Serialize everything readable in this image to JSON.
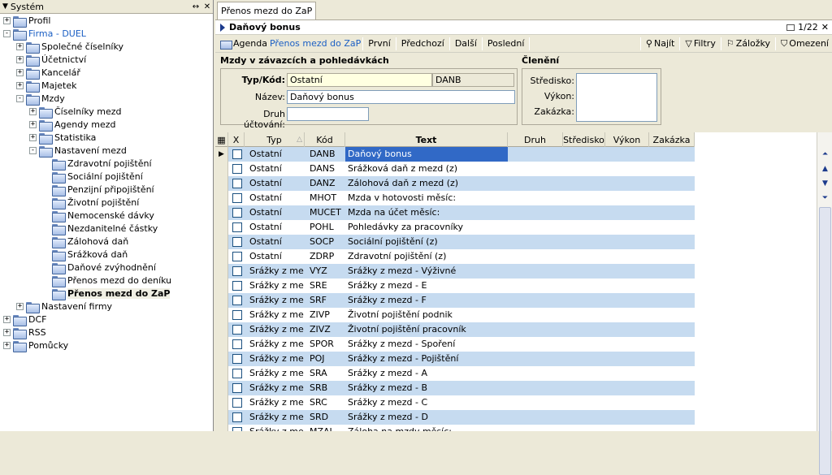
{
  "left_panel": {
    "title": "Systém"
  },
  "tree": [
    {
      "label": "Profil",
      "level": 0,
      "expander": "+"
    },
    {
      "label": "Firma - DUEL",
      "level": 0,
      "expander": "-",
      "blue": true
    },
    {
      "label": "Společné číselníky",
      "level": 1,
      "expander": "+"
    },
    {
      "label": "Účetnictví",
      "level": 1,
      "expander": "+"
    },
    {
      "label": "Kancelář",
      "level": 1,
      "expander": "+"
    },
    {
      "label": "Majetek",
      "level": 1,
      "expander": "+"
    },
    {
      "label": "Mzdy",
      "level": 1,
      "expander": "-"
    },
    {
      "label": "Číselníky mezd",
      "level": 2,
      "expander": "+"
    },
    {
      "label": "Agendy mezd",
      "level": 2,
      "expander": "+"
    },
    {
      "label": "Statistika",
      "level": 2,
      "expander": "+"
    },
    {
      "label": "Nastavení mezd",
      "level": 2,
      "expander": "-"
    },
    {
      "label": "Zdravotní pojištění",
      "level": 3,
      "expander": ""
    },
    {
      "label": "Sociální pojištění",
      "level": 3,
      "expander": ""
    },
    {
      "label": "Penzijní připojištění",
      "level": 3,
      "expander": ""
    },
    {
      "label": "Životní pojištění",
      "level": 3,
      "expander": ""
    },
    {
      "label": "Nemocenské dávky",
      "level": 3,
      "expander": ""
    },
    {
      "label": "Nezdanitelné částky",
      "level": 3,
      "expander": ""
    },
    {
      "label": "Zálohová daň",
      "level": 3,
      "expander": ""
    },
    {
      "label": "Srážková daň",
      "level": 3,
      "expander": ""
    },
    {
      "label": "Daňové zvýhodnění",
      "level": 3,
      "expander": ""
    },
    {
      "label": "Přenos mezd do deníku",
      "level": 3,
      "expander": ""
    },
    {
      "label": "Přenos mezd do ZaP",
      "level": 3,
      "expander": "",
      "selected": true
    },
    {
      "label": "Nastavení firmy",
      "level": 1,
      "expander": "+"
    },
    {
      "label": "DCF",
      "level": 0,
      "expander": "+"
    },
    {
      "label": "RSS",
      "level": 0,
      "expander": "+"
    },
    {
      "label": "Pomůcky",
      "level": 0,
      "expander": "+"
    }
  ],
  "tab": {
    "label": "Přenos mezd do ZaP"
  },
  "record": {
    "title": "Daňový bonus",
    "counter": "1/22"
  },
  "toolbar": {
    "agenda_label": "Agenda",
    "agenda_value": "Přenos mezd do ZaP",
    "first": "První",
    "prev": "Předchozí",
    "next": "Další",
    "last": "Poslední",
    "find": "Najít",
    "filters": "Filtry",
    "bookmarks": "Záložky",
    "limit": "Omezení"
  },
  "form": {
    "group1": "Mzdy v závazcích a pohledávkách",
    "group2": "Členění",
    "type_code_label": "Typ/Kód:",
    "type_value": "Ostatní",
    "code_value": "DANB",
    "name_label": "Název:",
    "name_value": "Daňový bonus",
    "accounting_label": "Druh účtování:",
    "accounting_value": "",
    "center_label": "Středisko:",
    "output_label": "Výkon:",
    "order_label": "Zakázka:"
  },
  "grid": {
    "columns": {
      "x": "X",
      "typ": "Typ",
      "kod": "Kód",
      "text": "Text",
      "druh": "Druh",
      "stredisko": "Středisko",
      "vykon": "Výkon",
      "zakazka": "Zakázka"
    },
    "rows": [
      {
        "typ": "Ostatní",
        "kod": "DANB",
        "text": "Daňový bonus"
      },
      {
        "typ": "Ostatní",
        "kod": "DANS",
        "text": "Srážková daň z mezd (z)"
      },
      {
        "typ": "Ostatní",
        "kod": "DANZ",
        "text": "Zálohová daň z mezd (z)"
      },
      {
        "typ": "Ostatní",
        "kod": "MHOT",
        "text": "Mzda v hotovosti měsíc:"
      },
      {
        "typ": "Ostatní",
        "kod": "MUCET",
        "text": "Mzda na účet měsíc:"
      },
      {
        "typ": "Ostatní",
        "kod": "POHL",
        "text": "Pohledávky za pracovníky"
      },
      {
        "typ": "Ostatní",
        "kod": "SOCP",
        "text": "Sociální pojištění (z)"
      },
      {
        "typ": "Ostatní",
        "kod": "ZDRP",
        "text": "Zdravotní pojištění (z)"
      },
      {
        "typ": "Srážky z mezd",
        "kod": "VYZ",
        "text": "Srážky z mezd - Výživné"
      },
      {
        "typ": "Srážky z mezd",
        "kod": "SRE",
        "text": "Srážky z mezd - E"
      },
      {
        "typ": "Srážky z mezd",
        "kod": "SRF",
        "text": "Srážky z mezd - F"
      },
      {
        "typ": "Srážky z mezd",
        "kod": "ZIVP",
        "text": "Životní pojištění podnik"
      },
      {
        "typ": "Srážky z mezd",
        "kod": "ZIVZ",
        "text": "Životní pojištění pracovník"
      },
      {
        "typ": "Srážky z mezd",
        "kod": "SPOR",
        "text": "Srážky z mezd - Spoření"
      },
      {
        "typ": "Srážky z mezd",
        "kod": "POJ",
        "text": "Srážky z mezd - Pojištění"
      },
      {
        "typ": "Srážky z mezd",
        "kod": "SRA",
        "text": "Srážky z mezd - A"
      },
      {
        "typ": "Srážky z mezd",
        "kod": "SRB",
        "text": "Srážky z mezd - B"
      },
      {
        "typ": "Srážky z mezd",
        "kod": "SRC",
        "text": "Srážky z mezd - C"
      },
      {
        "typ": "Srážky z mezd",
        "kod": "SRD",
        "text": "Srážky z mezd - D"
      },
      {
        "typ": "Srážky z mezd",
        "kod": "MZAL",
        "text": "Záloha na mzdy měsíc:"
      }
    ]
  }
}
